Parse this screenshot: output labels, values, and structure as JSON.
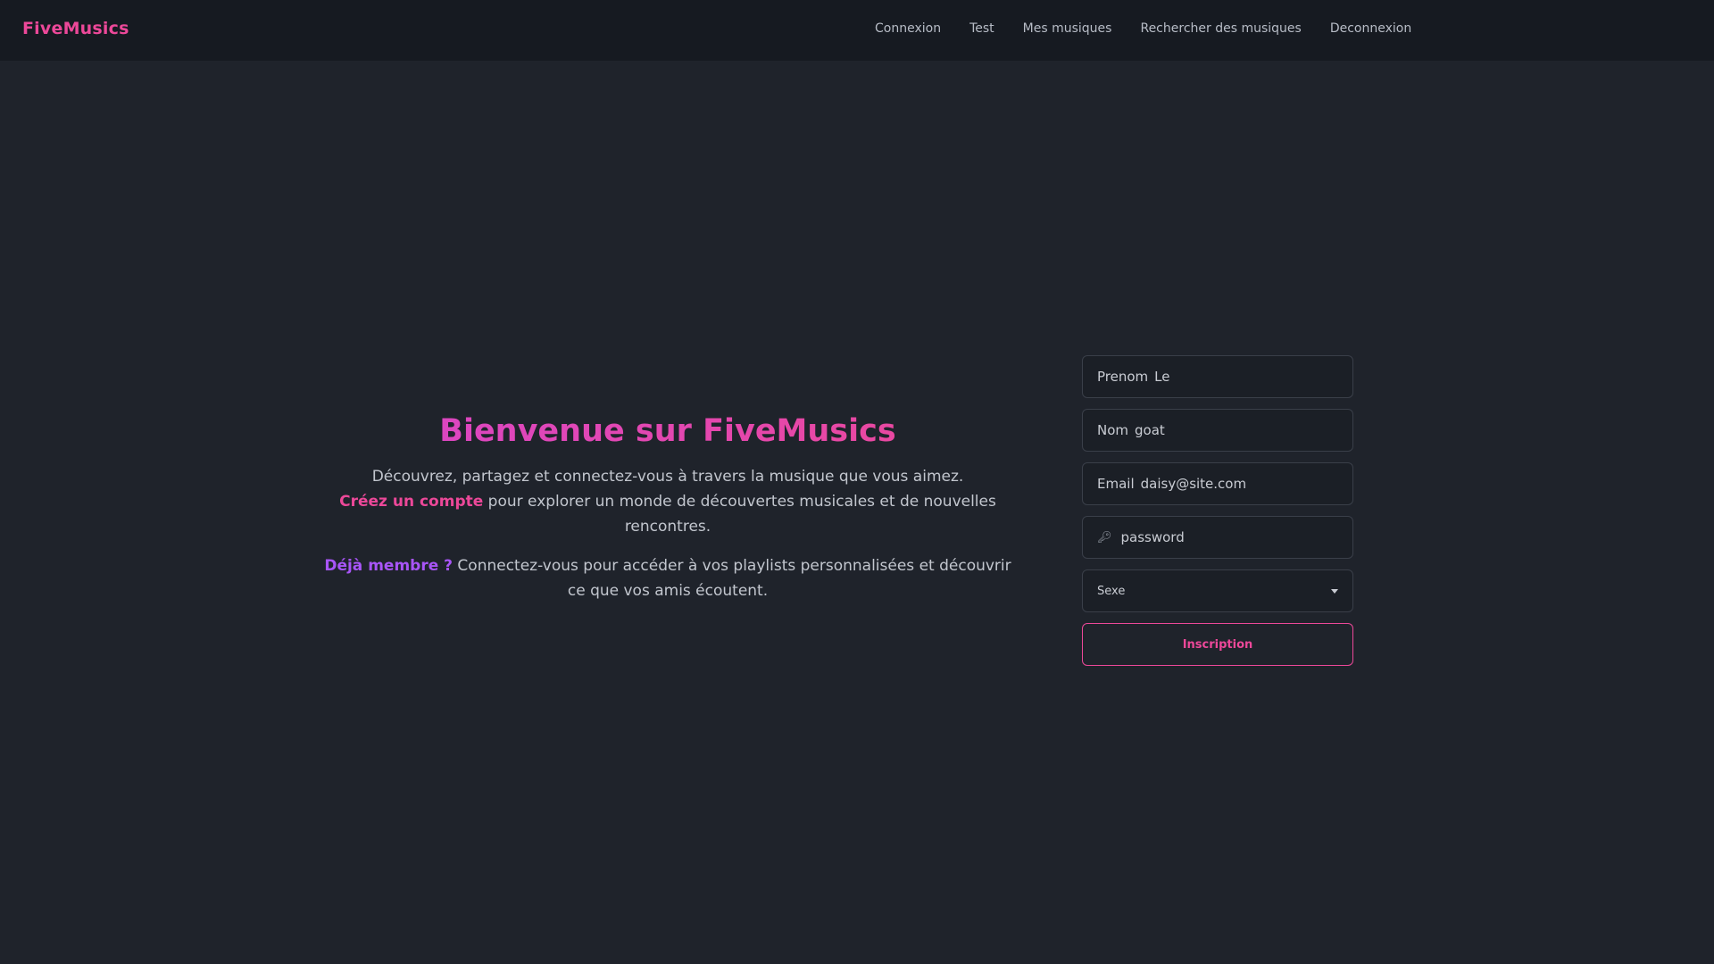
{
  "navbar": {
    "brand": "FiveMusics",
    "links": [
      "Connexion",
      "Test",
      "Mes musiques",
      "Rechercher des musiques",
      "Deconnexion"
    ]
  },
  "hero": {
    "title": "Bienvenue sur FiveMusics",
    "p1_line1": "Découvrez, partagez et connectez-vous à travers la musique que vous aimez.",
    "p1_highlight": "Créez un compte",
    "p1_rest": " pour explorer un monde de découvertes musicales et de nouvelles rencontres.",
    "p2_highlight": "Déjà membre ?",
    "p2_rest": " Connectez-vous pour accéder à vos playlists personnalisées et découvrir ce que vos amis écoutent."
  },
  "form": {
    "prenom_label": "Prenom",
    "prenom_value": "Le",
    "nom_label": "Nom",
    "nom_value": "goat",
    "email_label": "Email",
    "email_value": "daisy@site.com",
    "password_value": "password",
    "sexe_selected": "Sexe",
    "submit_label": "Inscription"
  },
  "colors": {
    "background": "#1f232b",
    "navbar": "#161a21",
    "accent_pink": "#ec4899",
    "accent_purple": "#a855f7"
  },
  "icons": {
    "password": "key-icon",
    "select": "caret-down-icon"
  }
}
